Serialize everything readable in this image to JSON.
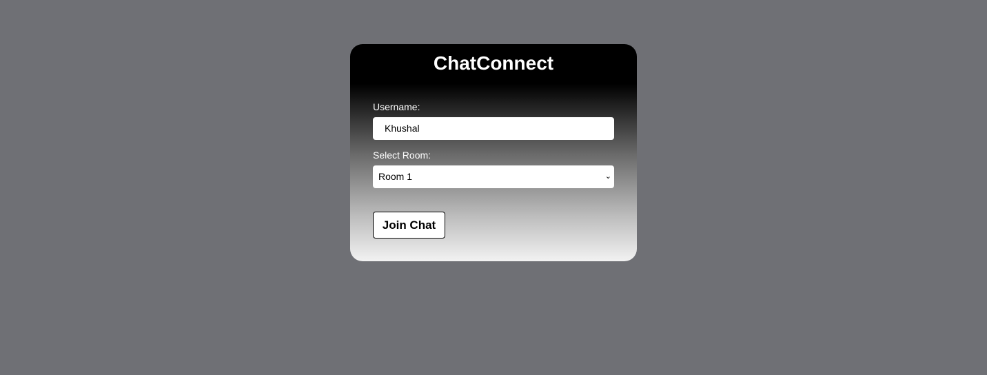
{
  "app": {
    "title": "ChatConnect"
  },
  "form": {
    "username_label": "Username:",
    "username_value": "Khushal",
    "room_label": "Select Room:",
    "room_selected": "Room 1",
    "join_label": "Join Chat"
  },
  "colors": {
    "page_background": "#6f7075",
    "card_top": "#000000",
    "card_bottom": "#f2f2f2",
    "text_light": "#ffffff",
    "button_text": "#000000"
  },
  "icons": {
    "room_select_chevron": "chevron-down-icon"
  }
}
